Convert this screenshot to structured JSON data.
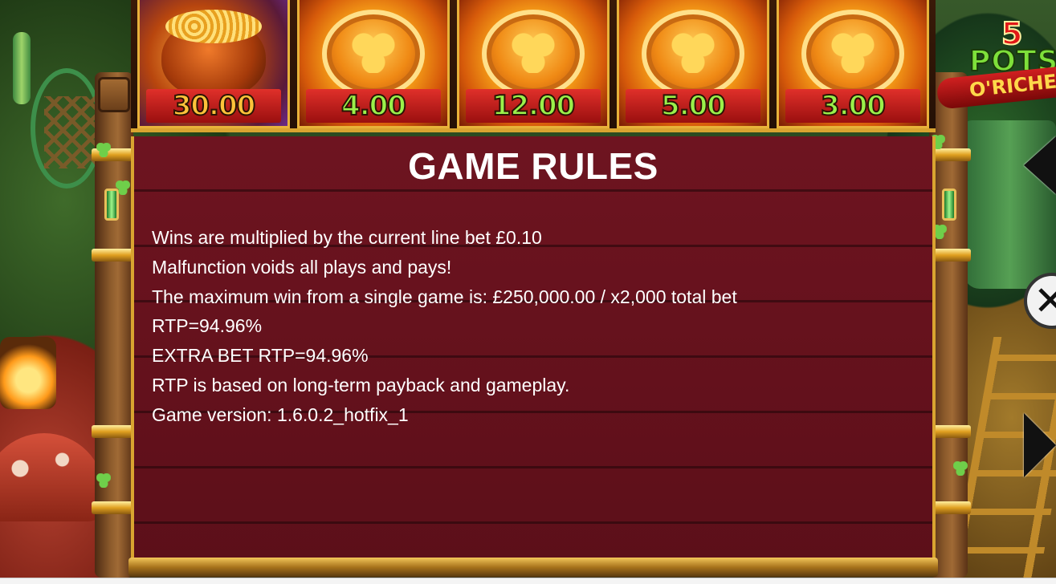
{
  "game": {
    "logo_number": "5",
    "logo_word": "POTS",
    "logo_sub": "O'RICHES"
  },
  "symbols": [
    {
      "kind": "pot",
      "value": "30.00",
      "color": "orange"
    },
    {
      "kind": "clover-coin",
      "value": "4.00",
      "color": "green"
    },
    {
      "kind": "clover-coin",
      "value": "12.00",
      "color": "green"
    },
    {
      "kind": "clover-coin",
      "value": "5.00",
      "color": "green"
    },
    {
      "kind": "clover-coin",
      "value": "3.00",
      "color": "green"
    }
  ],
  "rules": {
    "title": "GAME RULES",
    "lines": [
      "Wins are multiplied by the current line bet £0.10",
      "Malfunction voids all plays and pays!",
      "The maximum win from a single game is: £250,000.00 / x2,000 total bet",
      "RTP=94.96%",
      "EXTRA BET RTP=94.96%",
      "RTP is based on long-term payback and gameplay.",
      "Game version: 1.6.0.2_hotfix_1"
    ]
  },
  "controls": {
    "prev_icon": "triangle-left-icon",
    "close_icon": "close-x-icon",
    "close_glyph": "✕",
    "next_icon": "triangle-right-icon"
  },
  "colors": {
    "panel": "#6e1420",
    "gold_trim": "#d9a430",
    "value_orange": "#ffc23a",
    "value_green": "#9af04a"
  }
}
